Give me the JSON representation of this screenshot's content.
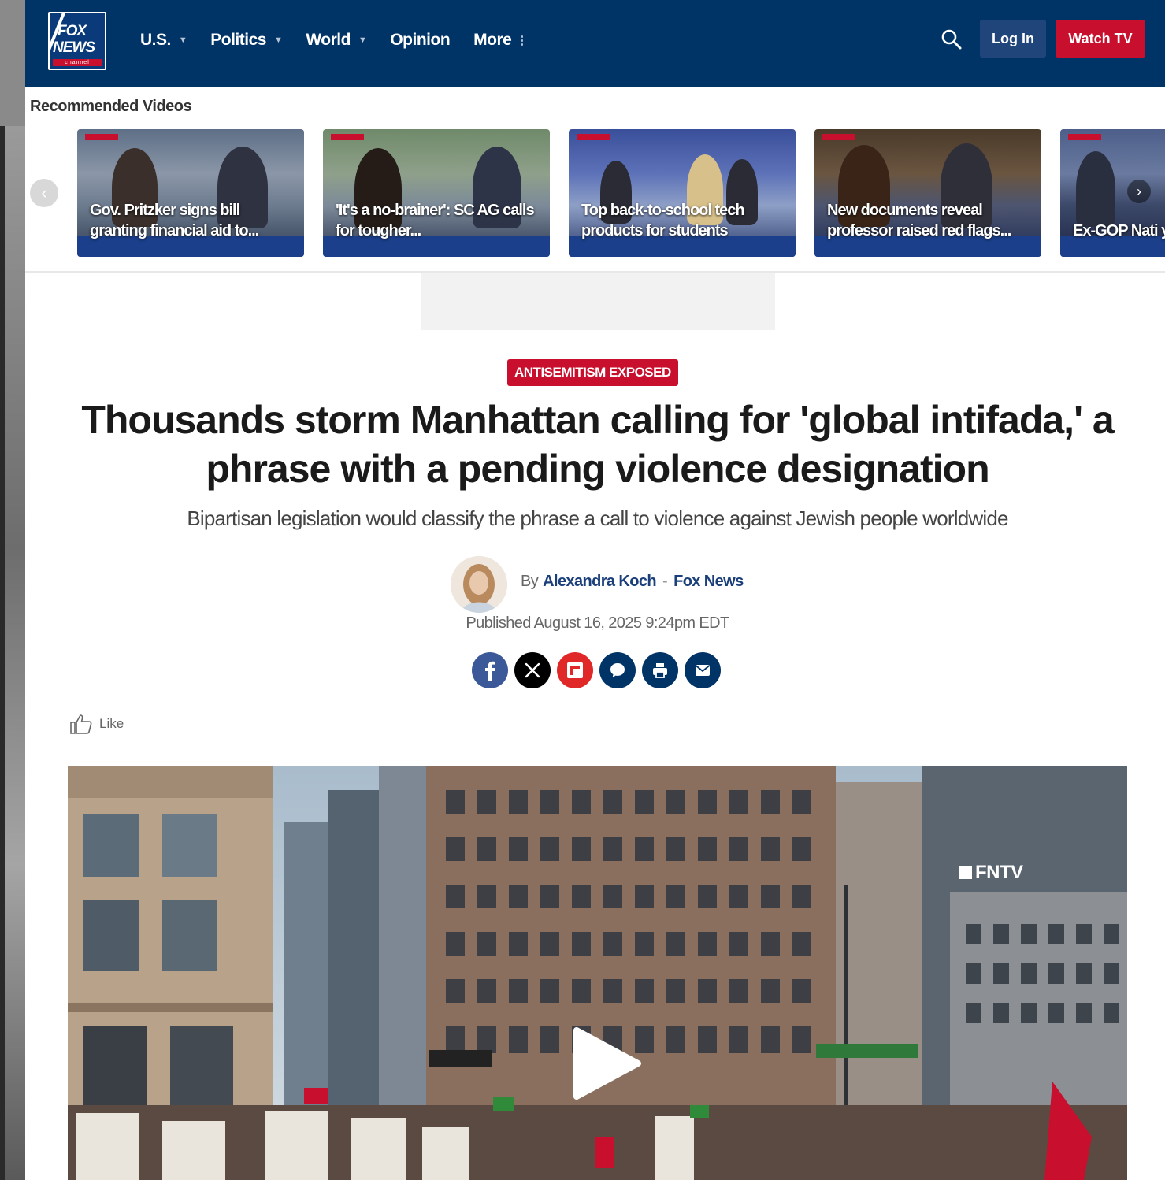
{
  "header": {
    "logo": {
      "line1": "FOX",
      "line2": "NEWS",
      "line3": "channel"
    },
    "nav": [
      {
        "label": "U.S.",
        "has_caret": true
      },
      {
        "label": "Politics",
        "has_caret": true
      },
      {
        "label": "World",
        "has_caret": true
      },
      {
        "label": "Opinion",
        "has_caret": false
      },
      {
        "label": "More",
        "has_more": true
      }
    ],
    "search_icon": "search-icon",
    "login_label": "Log In",
    "watch_label": "Watch TV",
    "colors": {
      "nav_bg": "#003366",
      "accent": "#c8102e",
      "login_bg": "#20457a"
    }
  },
  "recommended": {
    "title": "Recommended Videos",
    "cards": [
      {
        "caption": "Gov. Pritzker signs bill granting financial aid to..."
      },
      {
        "caption": "'It's a no-brainer': SC AG calls for tougher..."
      },
      {
        "caption": "Top back-to-school tech products for students"
      },
      {
        "caption": "New documents reveal professor raised red flags..."
      },
      {
        "caption": "Ex-GOP Nati you're rootin"
      }
    ]
  },
  "article": {
    "kicker": "ANTISEMITISM EXPOSED",
    "headline": "Thousands storm Manhattan calling for 'global intifada,' a phrase with a pending violence designation",
    "subhead": "Bipartisan legislation would classify the phrase a call to violence against Jewish people worldwide",
    "byline_prefix": "By",
    "author": "Alexandra Koch",
    "byline_sep": "-",
    "outlet": "Fox News",
    "published": "Published August 16, 2025 9:24pm EDT",
    "share": [
      {
        "icon": "facebook-icon",
        "color": "#3b5998"
      },
      {
        "icon": "x-icon",
        "color": "#000000"
      },
      {
        "icon": "flipboard-icon",
        "color": "#e12828"
      },
      {
        "icon": "comment-icon",
        "color": "#003366"
      },
      {
        "icon": "print-icon",
        "color": "#003366"
      },
      {
        "icon": "email-icon",
        "color": "#003366"
      }
    ],
    "like_label": "Like",
    "video": {
      "watermark": "FNTV"
    }
  }
}
